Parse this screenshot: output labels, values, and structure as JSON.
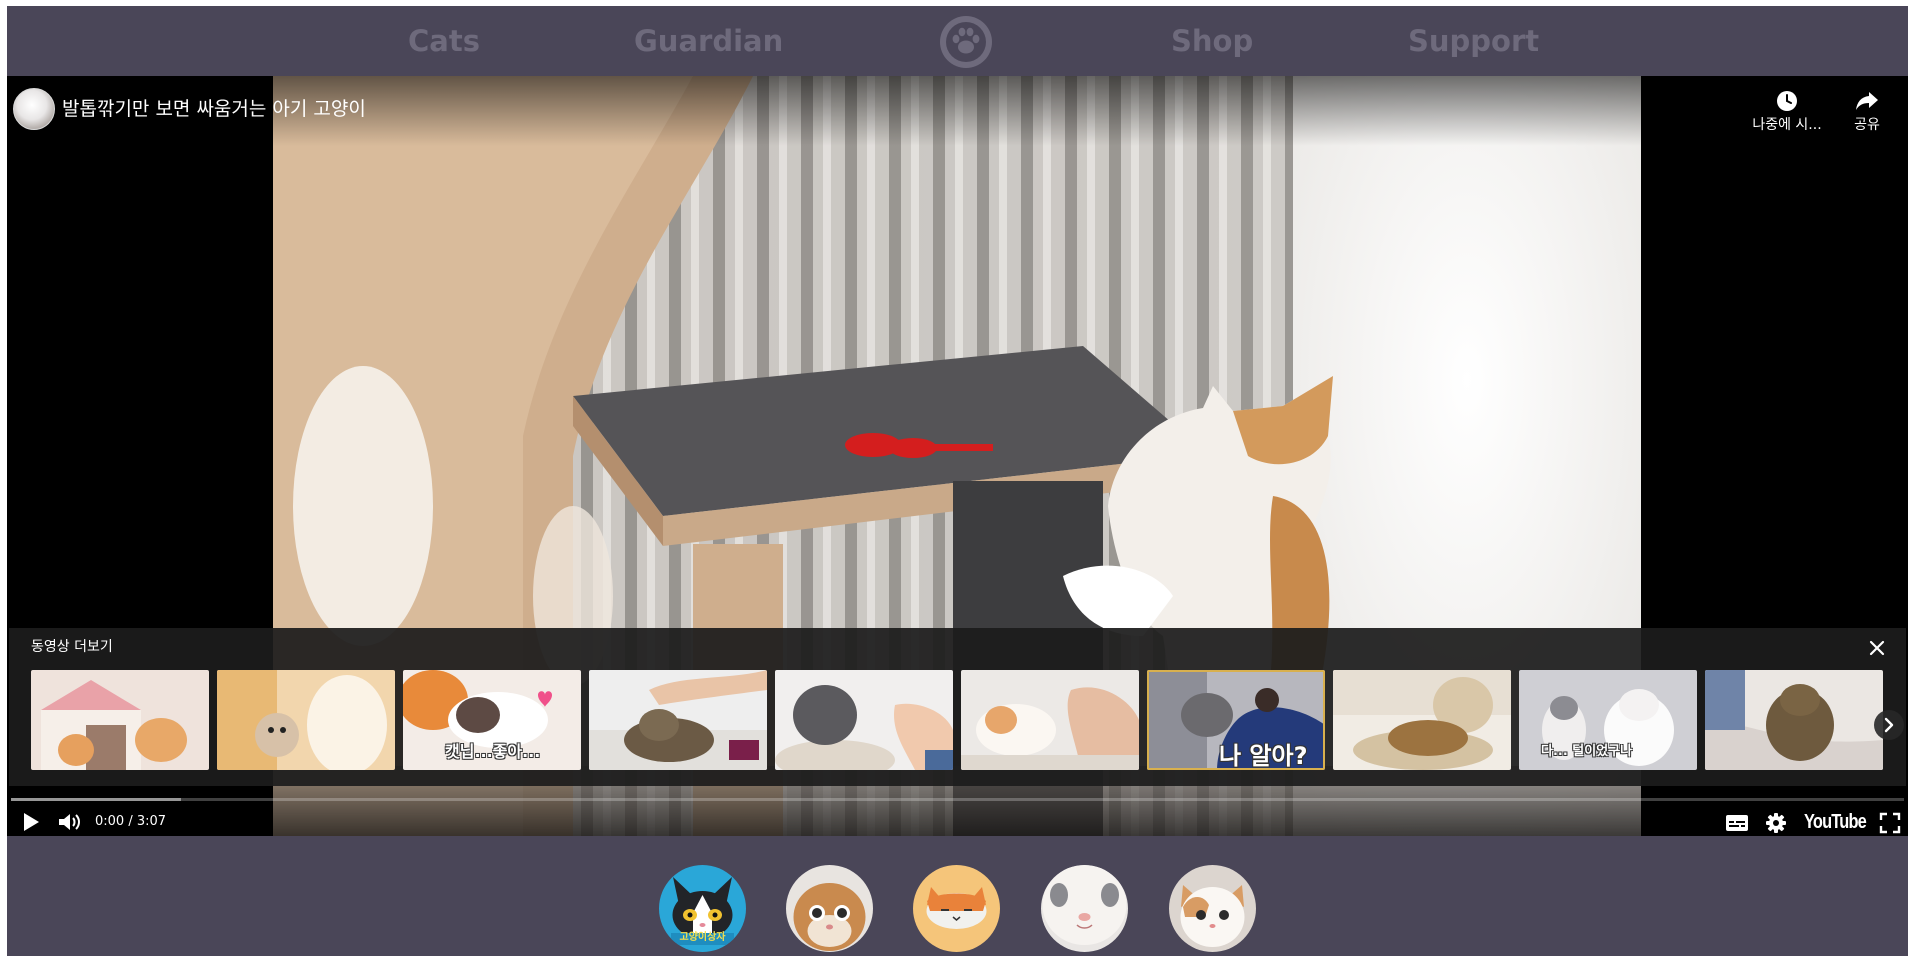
{
  "nav": {
    "items": [
      {
        "label": "Cats"
      },
      {
        "label": "Guardian"
      },
      {
        "label": "Shop"
      },
      {
        "label": "Support"
      }
    ],
    "logo_icon": "paw-icon"
  },
  "video": {
    "title": "발톱깎기만 보면 싸움거는 아기 고양이",
    "actions": [
      {
        "label": "나중에 시...",
        "icon": "clock-icon"
      },
      {
        "label": "공유",
        "icon": "share-arrow-icon"
      }
    ],
    "more_videos": {
      "title": "동영상 더보기",
      "close_icon": "close-icon",
      "next_icon": "chevron-right-icon",
      "thumbnails": [
        {
          "caption": ""
        },
        {
          "caption": ""
        },
        {
          "caption": "캣닙...좋아..."
        },
        {
          "caption": ""
        },
        {
          "caption": ""
        },
        {
          "caption": ""
        },
        {
          "caption": "나 알아?"
        },
        {
          "caption": ""
        },
        {
          "caption": "다... 털이었구나"
        },
        {
          "caption": ""
        }
      ]
    },
    "controls": {
      "time": "0:00 / 3:07",
      "progress_played": 0.0,
      "progress_loaded": 0.09,
      "logo": "YouTube",
      "icons": [
        "play-icon",
        "volume-icon",
        "subtitles-icon",
        "gear-icon",
        "fullscreen-icon"
      ]
    }
  },
  "avatars": [
    {
      "label": "고양이상자"
    },
    {
      "label": ""
    },
    {
      "label": ""
    },
    {
      "label": ""
    },
    {
      "label": ""
    }
  ],
  "colors": {
    "background": "#4a4658",
    "nav_text": "#6e6a7c",
    "progress": "#ff0000",
    "selected_thumb": "#d8b04e"
  }
}
